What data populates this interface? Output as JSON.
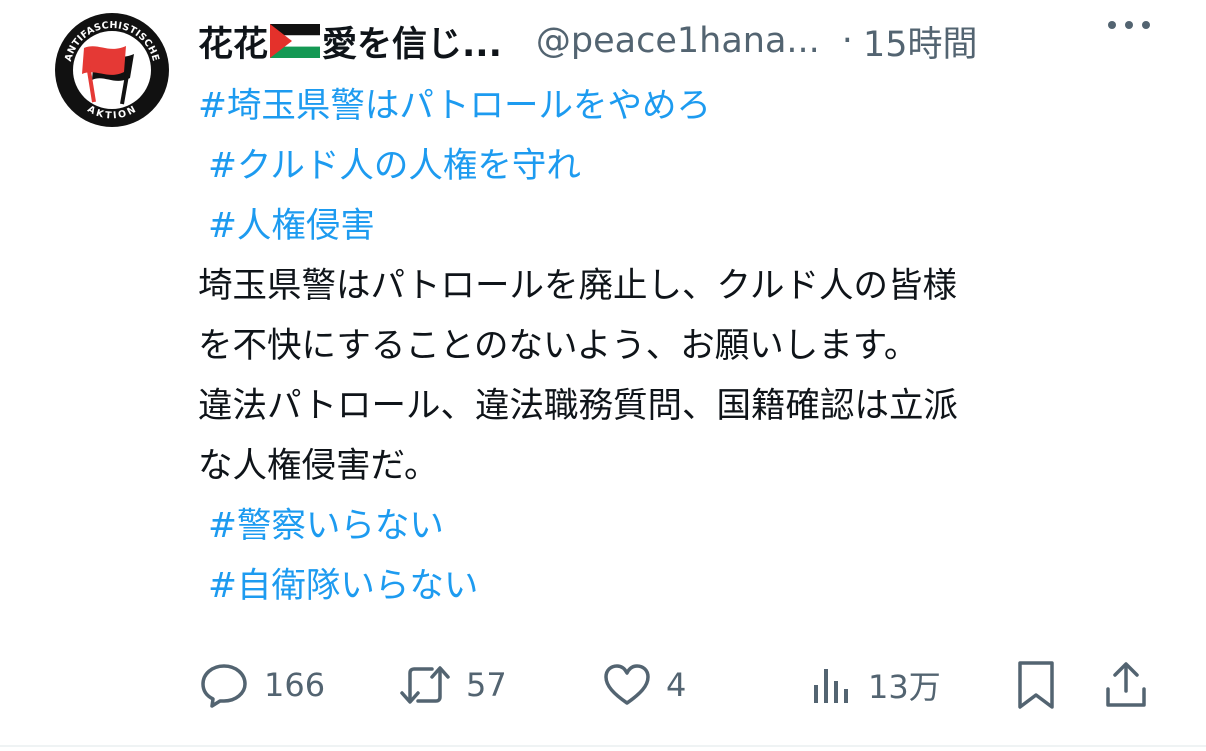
{
  "tweet": {
    "display_name_part1": "花花",
    "display_name_part2": "愛を信じ...",
    "flag": "palestine-flag",
    "handle": "@peace1hana...",
    "separator": "·",
    "time": "15時間",
    "avatar_icon": "antifascist-action-logo",
    "avatar_ring_text_top": "ANTIFASCHISTISCHE",
    "avatar_ring_text_bottom": "AKTION",
    "lines": [
      {
        "type": "tag",
        "text": "#埼玉県警はパトロールをやめろ"
      },
      {
        "type": "tag",
        "text": "#クルド人の人権を守れ"
      },
      {
        "type": "tag",
        "text": "#人権侵害"
      },
      {
        "type": "plain",
        "text": "埼玉県警はパトロールを廃止し、クルド人の皆様"
      },
      {
        "type": "plain",
        "text": "を不快にすることのないよう、お願いします。"
      },
      {
        "type": "plain",
        "text": "違法パトロール、違法職務質問、国籍確認は立派"
      },
      {
        "type": "plain",
        "text": "な人権侵害だ。"
      },
      {
        "type": "tag",
        "text": "#警察いらない"
      },
      {
        "type": "tag",
        "text": "#自衛隊いらない"
      }
    ]
  },
  "actions": {
    "reply_count": "166",
    "retweet_count": "57",
    "like_count": "4",
    "views_count": "13万"
  },
  "colors": {
    "hashtag": "#1d9bf0",
    "secondary_text": "#536471",
    "primary_text": "#0f1419",
    "flag_red": "#e4312b",
    "flag_green": "#149954",
    "antifa_red": "#e53935"
  }
}
